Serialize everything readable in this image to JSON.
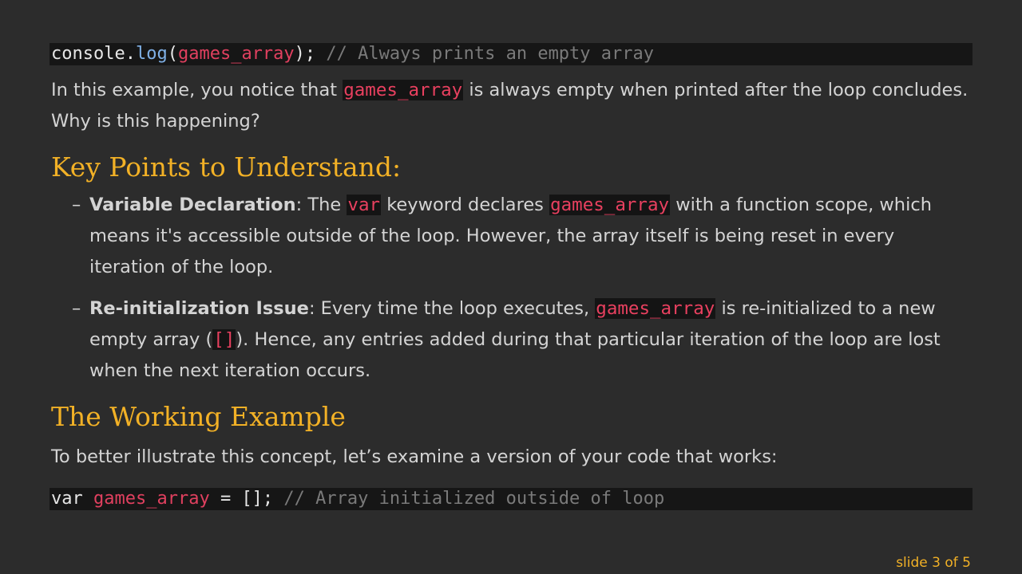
{
  "code_top": {
    "t1": "console",
    "t2": ".",
    "t3": "log",
    "t4": "(",
    "t5": "games_array",
    "t6": ");",
    "t7": " // Always prints an empty array"
  },
  "intro": {
    "pre": "In this example, you notice that ",
    "code": "games_array",
    "post": " is always empty when printed after the loop concludes. Why is this happening?"
  },
  "heading_key_points": "Key Points to Understand:",
  "bullets": [
    {
      "dash": "–",
      "title": "Variable Declaration",
      "p1": ": The ",
      "c1": "var",
      "p2": " keyword declares ",
      "c2": "games_array",
      "p3": " with a function scope, which means it's accessible outside of the loop. However, the array itself is being reset in every iteration of the loop."
    },
    {
      "dash": "–",
      "title": "Re-initialization Issue",
      "p1": ": Every time the loop executes, ",
      "c1": "games_array",
      "p2": " is re-initialized to a new empty array (",
      "c2": "[]",
      "p3": "). Hence, any entries added during that particular iteration of the loop are lost when the next iteration occurs."
    }
  ],
  "heading_working": "The Working Example",
  "working_intro": "To better illustrate this concept, let’s examine a version of your code that works:",
  "code_bottom": {
    "t1": "var",
    "t2": " ",
    "t3": "games_array",
    "t4": " = [];",
    "t5": " // Array initialized outside of loop"
  },
  "footer": "slide 3 of 5",
  "colors": {
    "background": "#2c2c2c",
    "heading": "#f2b126",
    "inline_code": "#e8405f",
    "code_bg": "#161616"
  }
}
